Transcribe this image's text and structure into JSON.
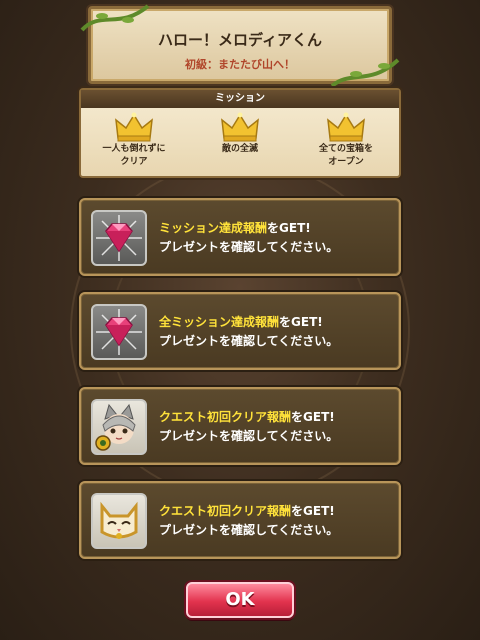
{
  "title": {
    "main": "ハロー！メロディアくん",
    "sub": "初級：またたび山へ！"
  },
  "missions": {
    "header": "ミッション",
    "items": [
      {
        "label_line1": "一人も倒れずに",
        "label_line2": "クリア",
        "icon": "gold-crown-icon"
      },
      {
        "label_line1": "敵の全滅",
        "label_line2": "",
        "icon": "gold-crown-icon"
      },
      {
        "label_line1": "全ての宝箱を",
        "label_line2": "オープン",
        "icon": "gold-crown-icon"
      }
    ]
  },
  "rewards": [
    {
      "highlight": "ミッション達成報酬",
      "suffix": "をGET!",
      "line2": "プレゼントを確認してください。",
      "icon": "pink-gem-icon"
    },
    {
      "highlight": "全ミッション達成報酬",
      "suffix": "をGET!",
      "line2": "プレゼントを確認してください。",
      "icon": "pink-gem-icon"
    },
    {
      "highlight": "クエスト初回クリア報酬",
      "suffix": "をGET!",
      "line2": "プレゼントを確認してください。",
      "icon": "cat-character-portrait-icon"
    },
    {
      "highlight": "クエスト初回クリア報酬",
      "suffix": "をGET!",
      "line2": "プレゼントを確認してください。",
      "icon": "cat-mask-item-icon"
    }
  ],
  "ok_button": {
    "label": "OK"
  },
  "colors": {
    "highlight_text": "#ffe23a",
    "ok_button": "#e2334e",
    "gem": "#e8407a",
    "crown": "#f2c230"
  }
}
